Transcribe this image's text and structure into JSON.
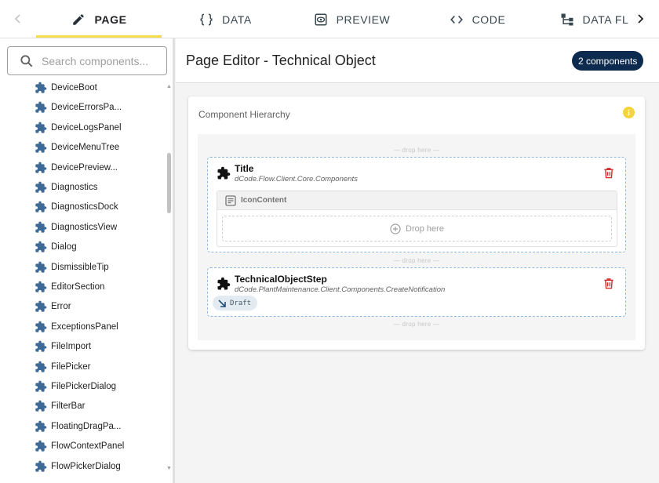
{
  "tabs": [
    {
      "label": "PAGE",
      "icon": "pencil-icon",
      "active": true
    },
    {
      "label": "DATA",
      "icon": "braces-icon",
      "active": false
    },
    {
      "label": "PREVIEW",
      "icon": "eye-icon",
      "active": false
    },
    {
      "label": "CODE",
      "icon": "code-icon",
      "active": false
    },
    {
      "label": "DATA FL",
      "icon": "flow-icon",
      "active": false
    }
  ],
  "sidebar": {
    "search_placeholder": "Search components...",
    "components": [
      "DeviceBoot",
      "DeviceErrorsPa...",
      "DeviceLogsPanel",
      "DeviceMenuTree",
      "DevicePreview...",
      "Diagnostics",
      "DiagnosticsDock",
      "DiagnosticsView",
      "Dialog",
      "DismissibleTip",
      "EditorSection",
      "Error",
      "ExceptionsPanel",
      "FileImport",
      "FilePicker",
      "FilePickerDialog",
      "FilterBar",
      "FloatingDragPa...",
      "FlowContextPanel",
      "FlowPickerDialog"
    ]
  },
  "header": {
    "title": "Page Editor - Technical Object",
    "component_count": "2 components"
  },
  "hierarchy": {
    "title": "Component Hierarchy",
    "drop_hint": "— drop here —",
    "nodes": [
      {
        "name": "Title",
        "namespace": "dCode.Flow.Client.Core.Components",
        "slot": {
          "name": "IconContent",
          "drop_label": "Drop here"
        }
      },
      {
        "name": "TechnicalObjectStep",
        "namespace": "dCode.PlantMaintenance.Client.Components.CreateNotification",
        "chip": "Draft"
      }
    ]
  },
  "colors": {
    "accent": "#f5dc52",
    "badge": "#0d2b4e",
    "puzzle": "#3d6a96",
    "delete": "#d32f2f",
    "info": "#f5d33a",
    "dashed_border": "#8fb8e0"
  }
}
